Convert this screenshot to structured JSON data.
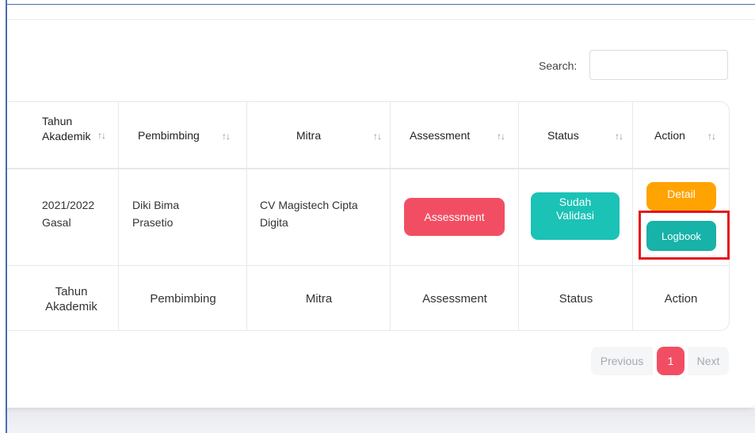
{
  "search": {
    "label": "Search:",
    "value": "",
    "placeholder": ""
  },
  "table": {
    "headers": [
      {
        "line1": "Tahun",
        "line2": "Akademik",
        "sort_icon": "↑↓"
      },
      {
        "label": "Pembimbing",
        "sort_icon": "↑↓"
      },
      {
        "label": "Mitra",
        "sort_icon": "↑↓"
      },
      {
        "label": "Assessment",
        "sort_icon": "↑↓"
      },
      {
        "label": "Status",
        "sort_icon": "↑↓"
      },
      {
        "label": "Action",
        "sort_icon": "↑↓"
      }
    ],
    "row": {
      "tahun_line1": "2021/2022",
      "tahun_line2": "Gasal",
      "pembimbing_line1": "Diki Bima",
      "pembimbing_line2": "Prasetio",
      "mitra_line1": "CV Magistech Cipta",
      "mitra_line2": "Digita",
      "assessment_button": "Assessment",
      "status_line1": "Sudah",
      "status_line2": "Validasi",
      "detail_button": "Detail",
      "logbook_button": "Logbook"
    },
    "footer": {
      "tahun_line1": "Tahun",
      "tahun_line2": "Akademik",
      "pembimbing": "Pembimbing",
      "mitra": "Mitra",
      "assessment": "Assessment",
      "status": "Status",
      "action": "Action"
    }
  },
  "pagination": {
    "previous": "Previous",
    "current_page": "1",
    "next": "Next"
  },
  "colors": {
    "assessment_button": "#f24e63",
    "status_badge": "#1bc2b6",
    "detail_button": "#ffa301",
    "logbook_button": "#17b2a8",
    "active_page": "#f24e63",
    "highlight_box": "#e4151b"
  }
}
